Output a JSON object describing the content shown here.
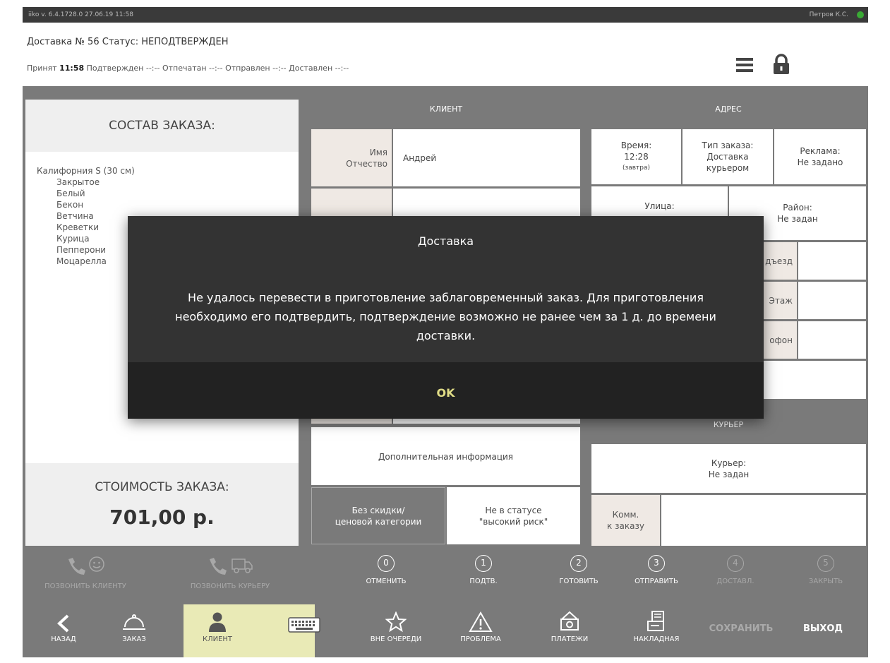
{
  "titlebar": {
    "version": "iiko v. 6.4.1728.0   27.06.19  11:58",
    "user": "Петров К.С."
  },
  "header": {
    "line1": "Доставка № 56  Статус: НЕПОДТВЕРЖДЕН",
    "accepted_label": "Принят",
    "accepted_time": "11:58",
    "rest": " Подтвержден --:--  Отпечатан --:--  Отправлен --:--  Доставлен --:--"
  },
  "order": {
    "title": "СОСТАВ ЗАКАЗА:",
    "item": "Калифорния S (30 см)",
    "modifiers": [
      "Закрытое",
      "Белый",
      "Бекон",
      "Ветчина",
      "Креветки",
      "Курица",
      "Пепперони",
      "Моцарелла"
    ],
    "cost_title": "СТОИМОСТЬ ЗАКАЗА:",
    "cost": "701,00 р."
  },
  "client": {
    "header": "КЛИЕНТ",
    "name_label": "Имя\nОтчество",
    "name_value": "Андрей",
    "extra_info": "Дополнительная информация",
    "no_discount": "Без скидки/\nценовой категории",
    "risk": "Не в статусе\n\"высокий риск\""
  },
  "address": {
    "header": "АДРЕС",
    "time_label": "Время:",
    "time_value": "12:28",
    "time_note": "(завтра)",
    "type_label": "Тип заказа:",
    "type_value": "Доставка\nкурьером",
    "ad_label": "Реклама:",
    "ad_value": "Не задано",
    "street_label": "Улица:",
    "district_label": "Район:",
    "district_value": "Не задан",
    "entrance_label": "дъезд",
    "floor_label": "Этаж",
    "intercom_label": "офон"
  },
  "courier": {
    "header": "КУРЬЕР",
    "label": "Курьер:",
    "value": "Не задан",
    "comment_label": "Комм.\nк заказу"
  },
  "status_actions": [
    {
      "label": "ПОЗВОНИТЬ КЛИЕНТУ",
      "icon": "phone-smile-icon"
    },
    {
      "label": "ПОЗВОНИТЬ КУРЬЕРУ",
      "icon": "phone-truck-icon"
    },
    {
      "num": "0",
      "label": "ОТМЕНИТЬ"
    },
    {
      "num": "1",
      "label": "ПОДТВ."
    },
    {
      "num": "2",
      "label": "ГОТОВИТЬ"
    },
    {
      "num": "3",
      "label": "ОТПРАВИТЬ"
    },
    {
      "num": "4",
      "label": "ДОСТАВЛ."
    },
    {
      "num": "5",
      "label": "ЗАКРЫТЬ"
    }
  ],
  "bottom_nav": {
    "back": "НАЗАД",
    "order": "ЗАКАЗ",
    "client": "КЛИЕНТ",
    "out_of_turn": "ВНЕ ОЧЕРЕДИ",
    "problem": "ПРОБЛЕМА",
    "payments": "ПЛАТЕЖИ",
    "invoice": "НАКЛАДНАЯ",
    "save": "СОХРАНИТЬ",
    "exit": "ВЫХОД"
  },
  "dialog": {
    "title": "Доставка",
    "message_lines": [
      "Не удалось перевести в приготовление заблаговременный заказ. Для приготовления",
      "необходимо его подтвердить, подтверждение возможно не ранее чем за 1 д. до времени",
      "доставки."
    ],
    "ok": "OK"
  },
  "colors": {
    "accent": "#e9eab6",
    "ok": "#e0dc86",
    "panel": "#7a7a7a",
    "status_ok": "#3aaa35"
  }
}
